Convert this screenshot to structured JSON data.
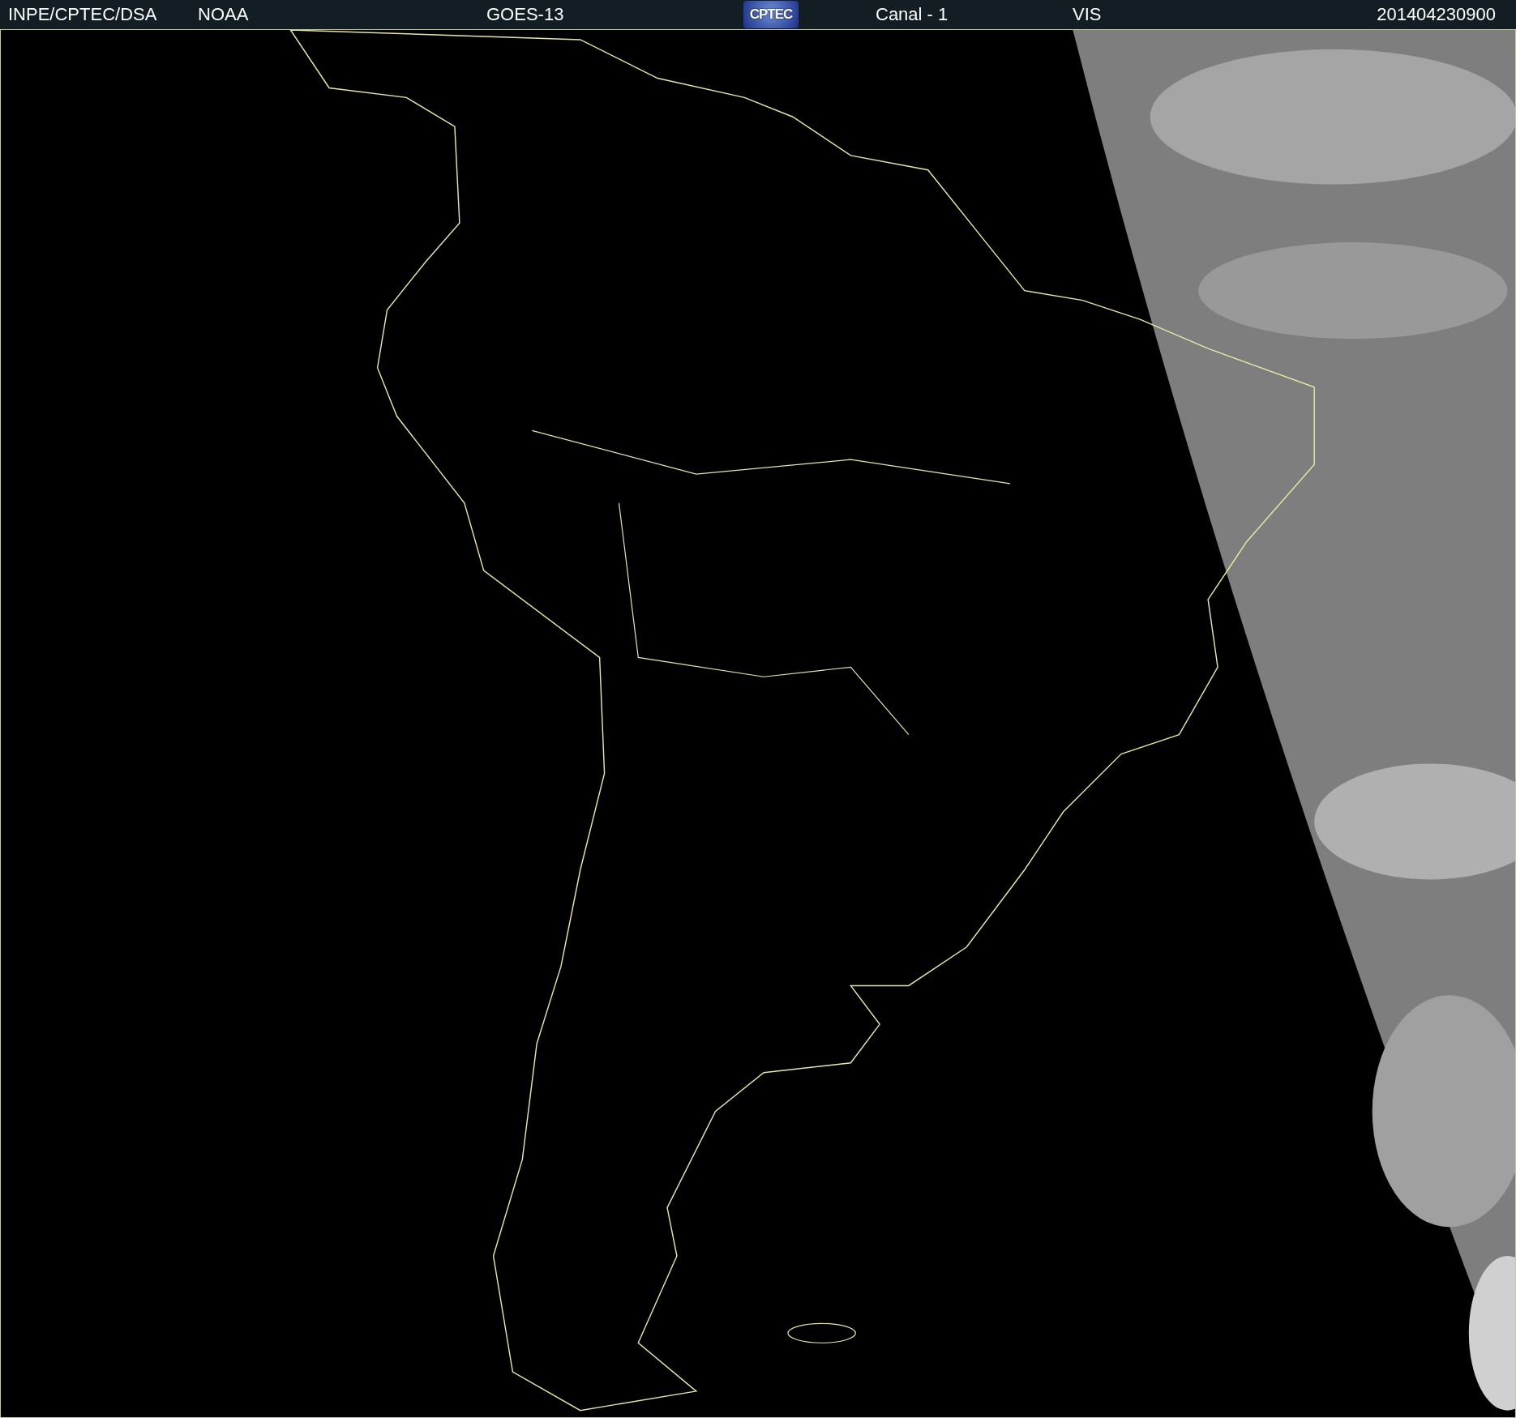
{
  "header": {
    "source": "INPE/CPTEC/DSA",
    "agency": "NOAA",
    "satellite": "GOES-13",
    "logo_text": "CPTEC",
    "channel": "Canal - 1",
    "band": "VIS",
    "timestamp": "201404230900"
  }
}
